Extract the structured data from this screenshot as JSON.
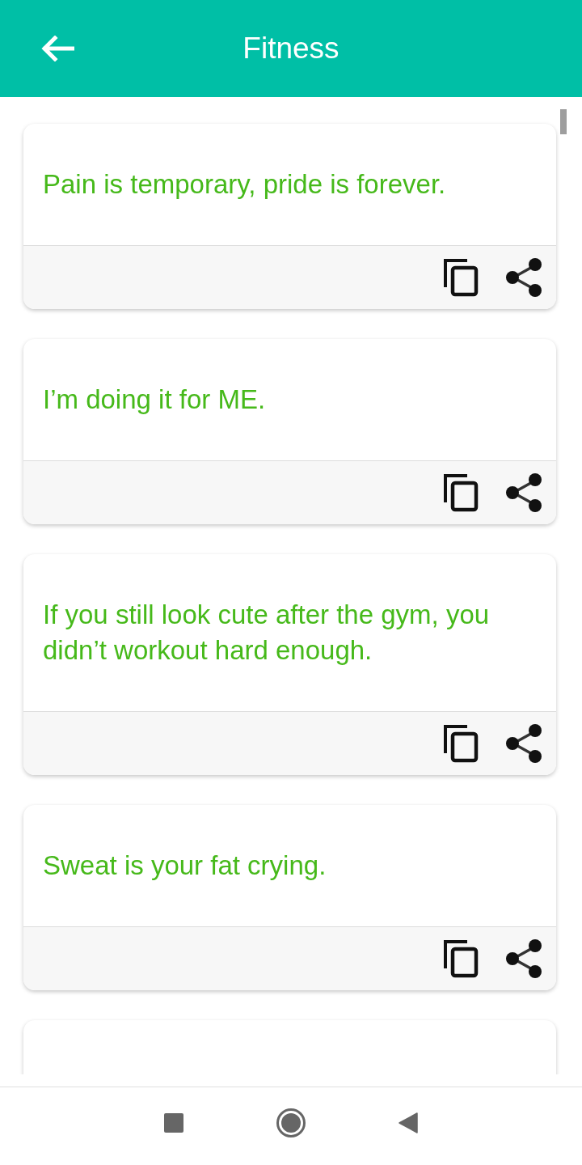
{
  "app_bar": {
    "title": "Fitness"
  },
  "quotes": [
    {
      "text": "Pain is temporary, pride is forever."
    },
    {
      "text": "I’m doing it for ME."
    },
    {
      "text": "If you still look cute after the gym, you didn’t workout hard enough."
    },
    {
      "text": "Sweat is your fat crying."
    }
  ]
}
